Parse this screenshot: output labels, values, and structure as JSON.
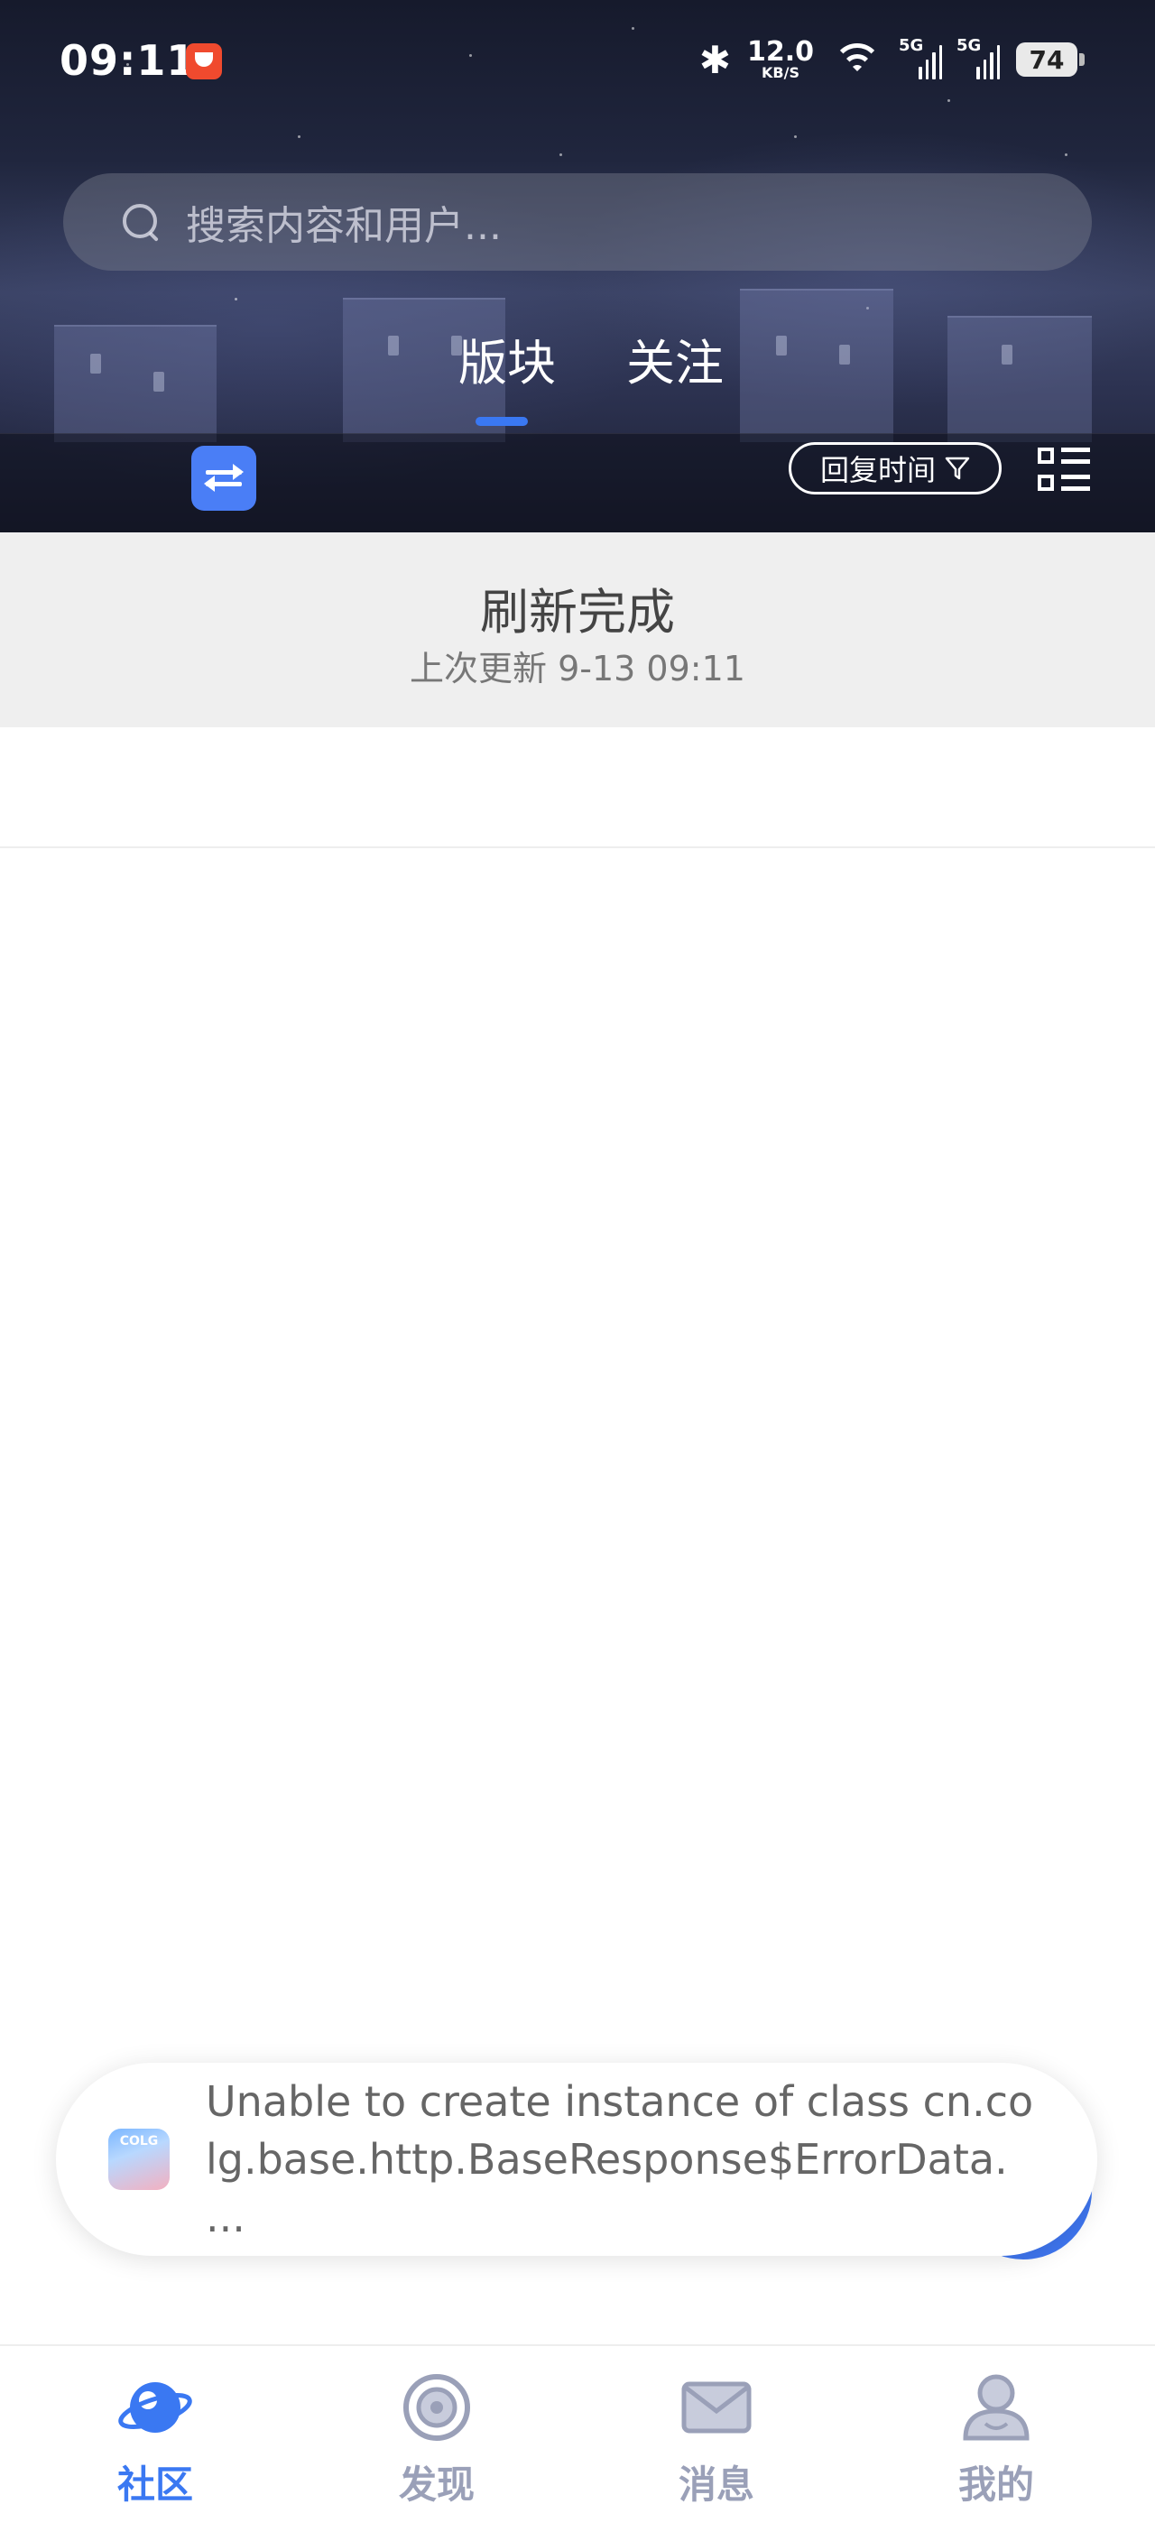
{
  "status_bar": {
    "time": "09:11",
    "net_speed": "12.0",
    "net_unit": "KB/S",
    "signal_1": "5G",
    "signal_2": "5G",
    "battery": "74"
  },
  "search": {
    "placeholder": "搜索内容和用户..."
  },
  "tabs": [
    {
      "label": "版块",
      "active": true
    },
    {
      "label": "关注",
      "active": false
    }
  ],
  "toolbar": {
    "sort_label": "回复时间"
  },
  "refresh": {
    "title": "刷新完成",
    "subtitle": "上次更新 9-13 09:11"
  },
  "toast": {
    "app_badge": "COLG",
    "message": "Unable to create instance of class cn.colg.base.http.BaseResponse$ErrorData. ..."
  },
  "bottom_nav": [
    {
      "label": "社区",
      "active": true
    },
    {
      "label": "发现",
      "active": false
    },
    {
      "label": "消息",
      "active": false
    },
    {
      "label": "我的",
      "active": false
    }
  ],
  "colors": {
    "accent": "#3a78f2",
    "inactive_nav": "#9aa0b8"
  }
}
